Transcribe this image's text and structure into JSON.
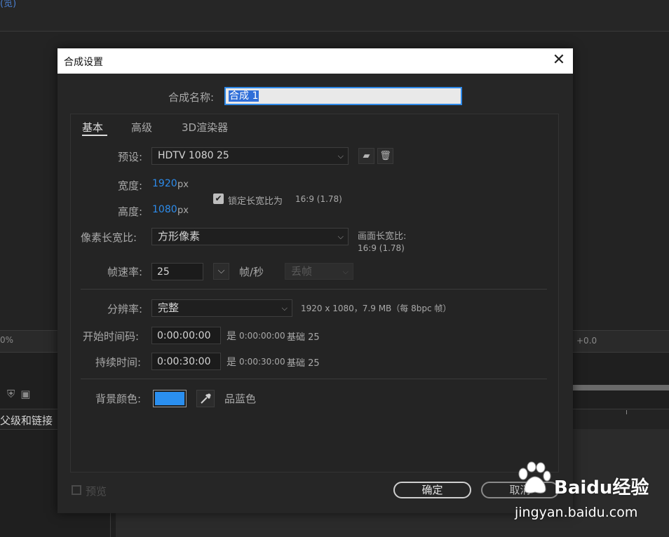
{
  "background": {
    "top_text": "(览) ",
    "zoom": "0%",
    "offset": "+0.0",
    "layer_label": "父级和链接"
  },
  "dialog": {
    "title": "合成设置",
    "close_icon": "close-icon",
    "comp_name_label": "合成名称:",
    "comp_name_value": "合成 1",
    "tabs": [
      "基本",
      "高级",
      "3D渲染器"
    ],
    "preset_label": "预设:",
    "preset_value": "HDTV 1080 25",
    "width_label": "宽度:",
    "width_value": "1920",
    "width_unit": "px",
    "height_label": "高度:",
    "height_value": "1080",
    "height_unit": "px",
    "lock_aspect_label": "锁定长宽比为",
    "lock_aspect_value": "16:9 (1.78)",
    "lock_aspect_checked": true,
    "pixel_aspect_label": "像素长宽比:",
    "pixel_aspect_value": "方形像素",
    "frame_aspect_label": "画面长宽比:",
    "frame_aspect_value": "16:9 (1.78)",
    "fps_label": "帧速率:",
    "fps_value": "25",
    "fps_unit": "帧/秒",
    "drop_frame_value": "丢帧",
    "resolution_label": "分辨率:",
    "resolution_value": "完整",
    "resolution_info": "1920 x 1080，7.9 MB（每 8bpc 帧）",
    "start_tc_label": "开始时间码:",
    "start_tc_value": "0:00:00:00",
    "start_tc_is": "是",
    "start_tc_info": "0:00:00:00",
    "start_tc_base": "基础 25",
    "duration_label": "持续时间:",
    "duration_value": "0:00:30:00",
    "duration_is": "是",
    "duration_info": "0:00:30:00",
    "duration_base": "基础 25",
    "bg_color_label": "背景颜色:",
    "bg_color_hex": "#2a8ff0",
    "bg_color_name": "品蓝色",
    "preview_label": "预览",
    "ok_label": "确定",
    "cancel_label": "取消"
  },
  "watermark": {
    "brand": "Baidu经验",
    "url": "jingyan.baidu.com"
  }
}
